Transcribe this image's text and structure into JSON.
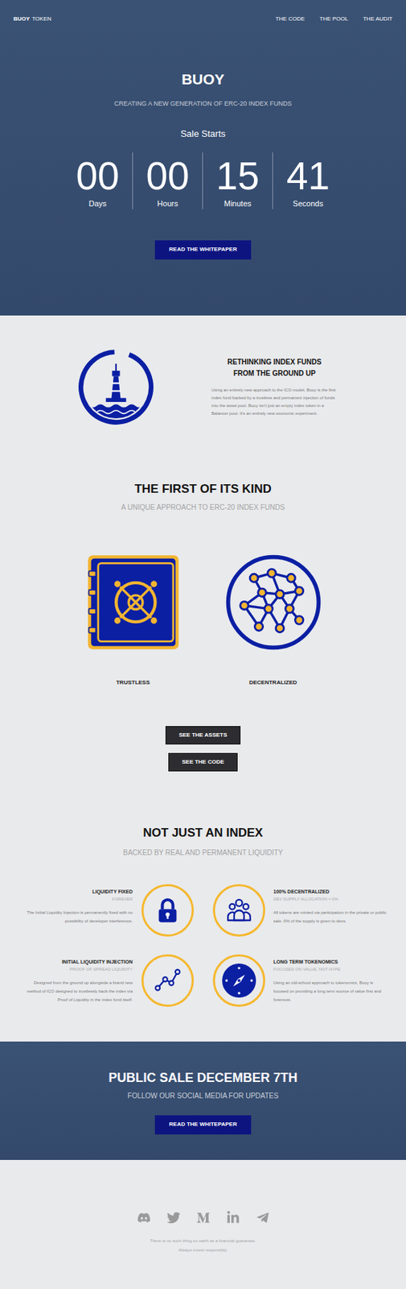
{
  "nav": {
    "logo": {
      "bold": "BUOY",
      "rest": "TOKEN"
    },
    "links": [
      "THE CODE",
      "THE POOL",
      "THE AUDIT"
    ]
  },
  "hero": {
    "title": "BUOY",
    "subtitle": "CREATING A NEW GENERATION OF ERC-20 INDEX FUNDS",
    "sale_label": "Sale Starts",
    "countdown": [
      {
        "value": "00",
        "unit": "Days"
      },
      {
        "value": "00",
        "unit": "Hours"
      },
      {
        "value": "15",
        "unit": "Minutes"
      },
      {
        "value": "41",
        "unit": "Seconds"
      }
    ],
    "button": "READ THE WHITEPAPER"
  },
  "about": {
    "heading": [
      "RETHINKING INDEX FUNDS",
      "FROM THE GROUND UP"
    ],
    "body": "Using an entirely new approach to the ICO model, Buoy is the first index fund backed by a trustless and permanent injection of funds into the asset pool. Buoy isn't just an empty index token in a Balancer pool. It's an entirely new economic experiment."
  },
  "first_of_kind": {
    "title": "THE FIRST OF ITS KIND",
    "subtitle": "A UNIQUE APPROACH TO ERC-20 INDEX FUNDS",
    "features": [
      {
        "label": "TRUSTLESS",
        "kind": "vault"
      },
      {
        "label": "DECENTRALIZED",
        "kind": "globe"
      }
    ],
    "buttons": [
      "SEE THE ASSETS",
      "SEE THE CODE"
    ]
  },
  "index": {
    "title": "NOT JUST AN INDEX",
    "subtitle": "BACKED BY REAL AND PERMANENT LIQUIDITY",
    "features": [
      {
        "title": "LIQUIDITY FIXED",
        "tag": "FOREVER",
        "body": "The Initial Liquidity Injection is permanently fixed with no possibility of developer interference.",
        "kind": "lock"
      },
      {
        "title": "100% DECENTRALIZED",
        "tag": "DEV SUPPLY ALLOCATION = 0%",
        "body": "All tokens are minted via participation in the private or public sale. 0% of the supply is given to devs.",
        "kind": "people"
      },
      {
        "title": "INITIAL LIQUIDITY INJECTION",
        "tag": "PROOF OF SPREAD LIQUIDITY",
        "body": "Designed from the ground up alongside a brand new method of ICO designed to trustlessly back the index via Proof of Liquidity in the index fund itself.",
        "kind": "chart"
      },
      {
        "title": "LONG TERM TOKENOMICS",
        "tag": "FOCUSED ON VALUE, NOT HYPE",
        "body": "Using an old-school approach to tokenomics, Buoy is focused on providing a long term source of value first and foremost.",
        "kind": "compass"
      }
    ]
  },
  "sale": {
    "title": "PUBLIC SALE DECEMBER 7TH",
    "subtitle": "FOLLOW OUR SOCIAL MEDIA FOR UPDATES",
    "button": "READ THE WHITEPAPER"
  },
  "footer": {
    "disclaimer": [
      "There is no such thing on earth as a financial guarantee.",
      "Always invest responsibly."
    ]
  }
}
